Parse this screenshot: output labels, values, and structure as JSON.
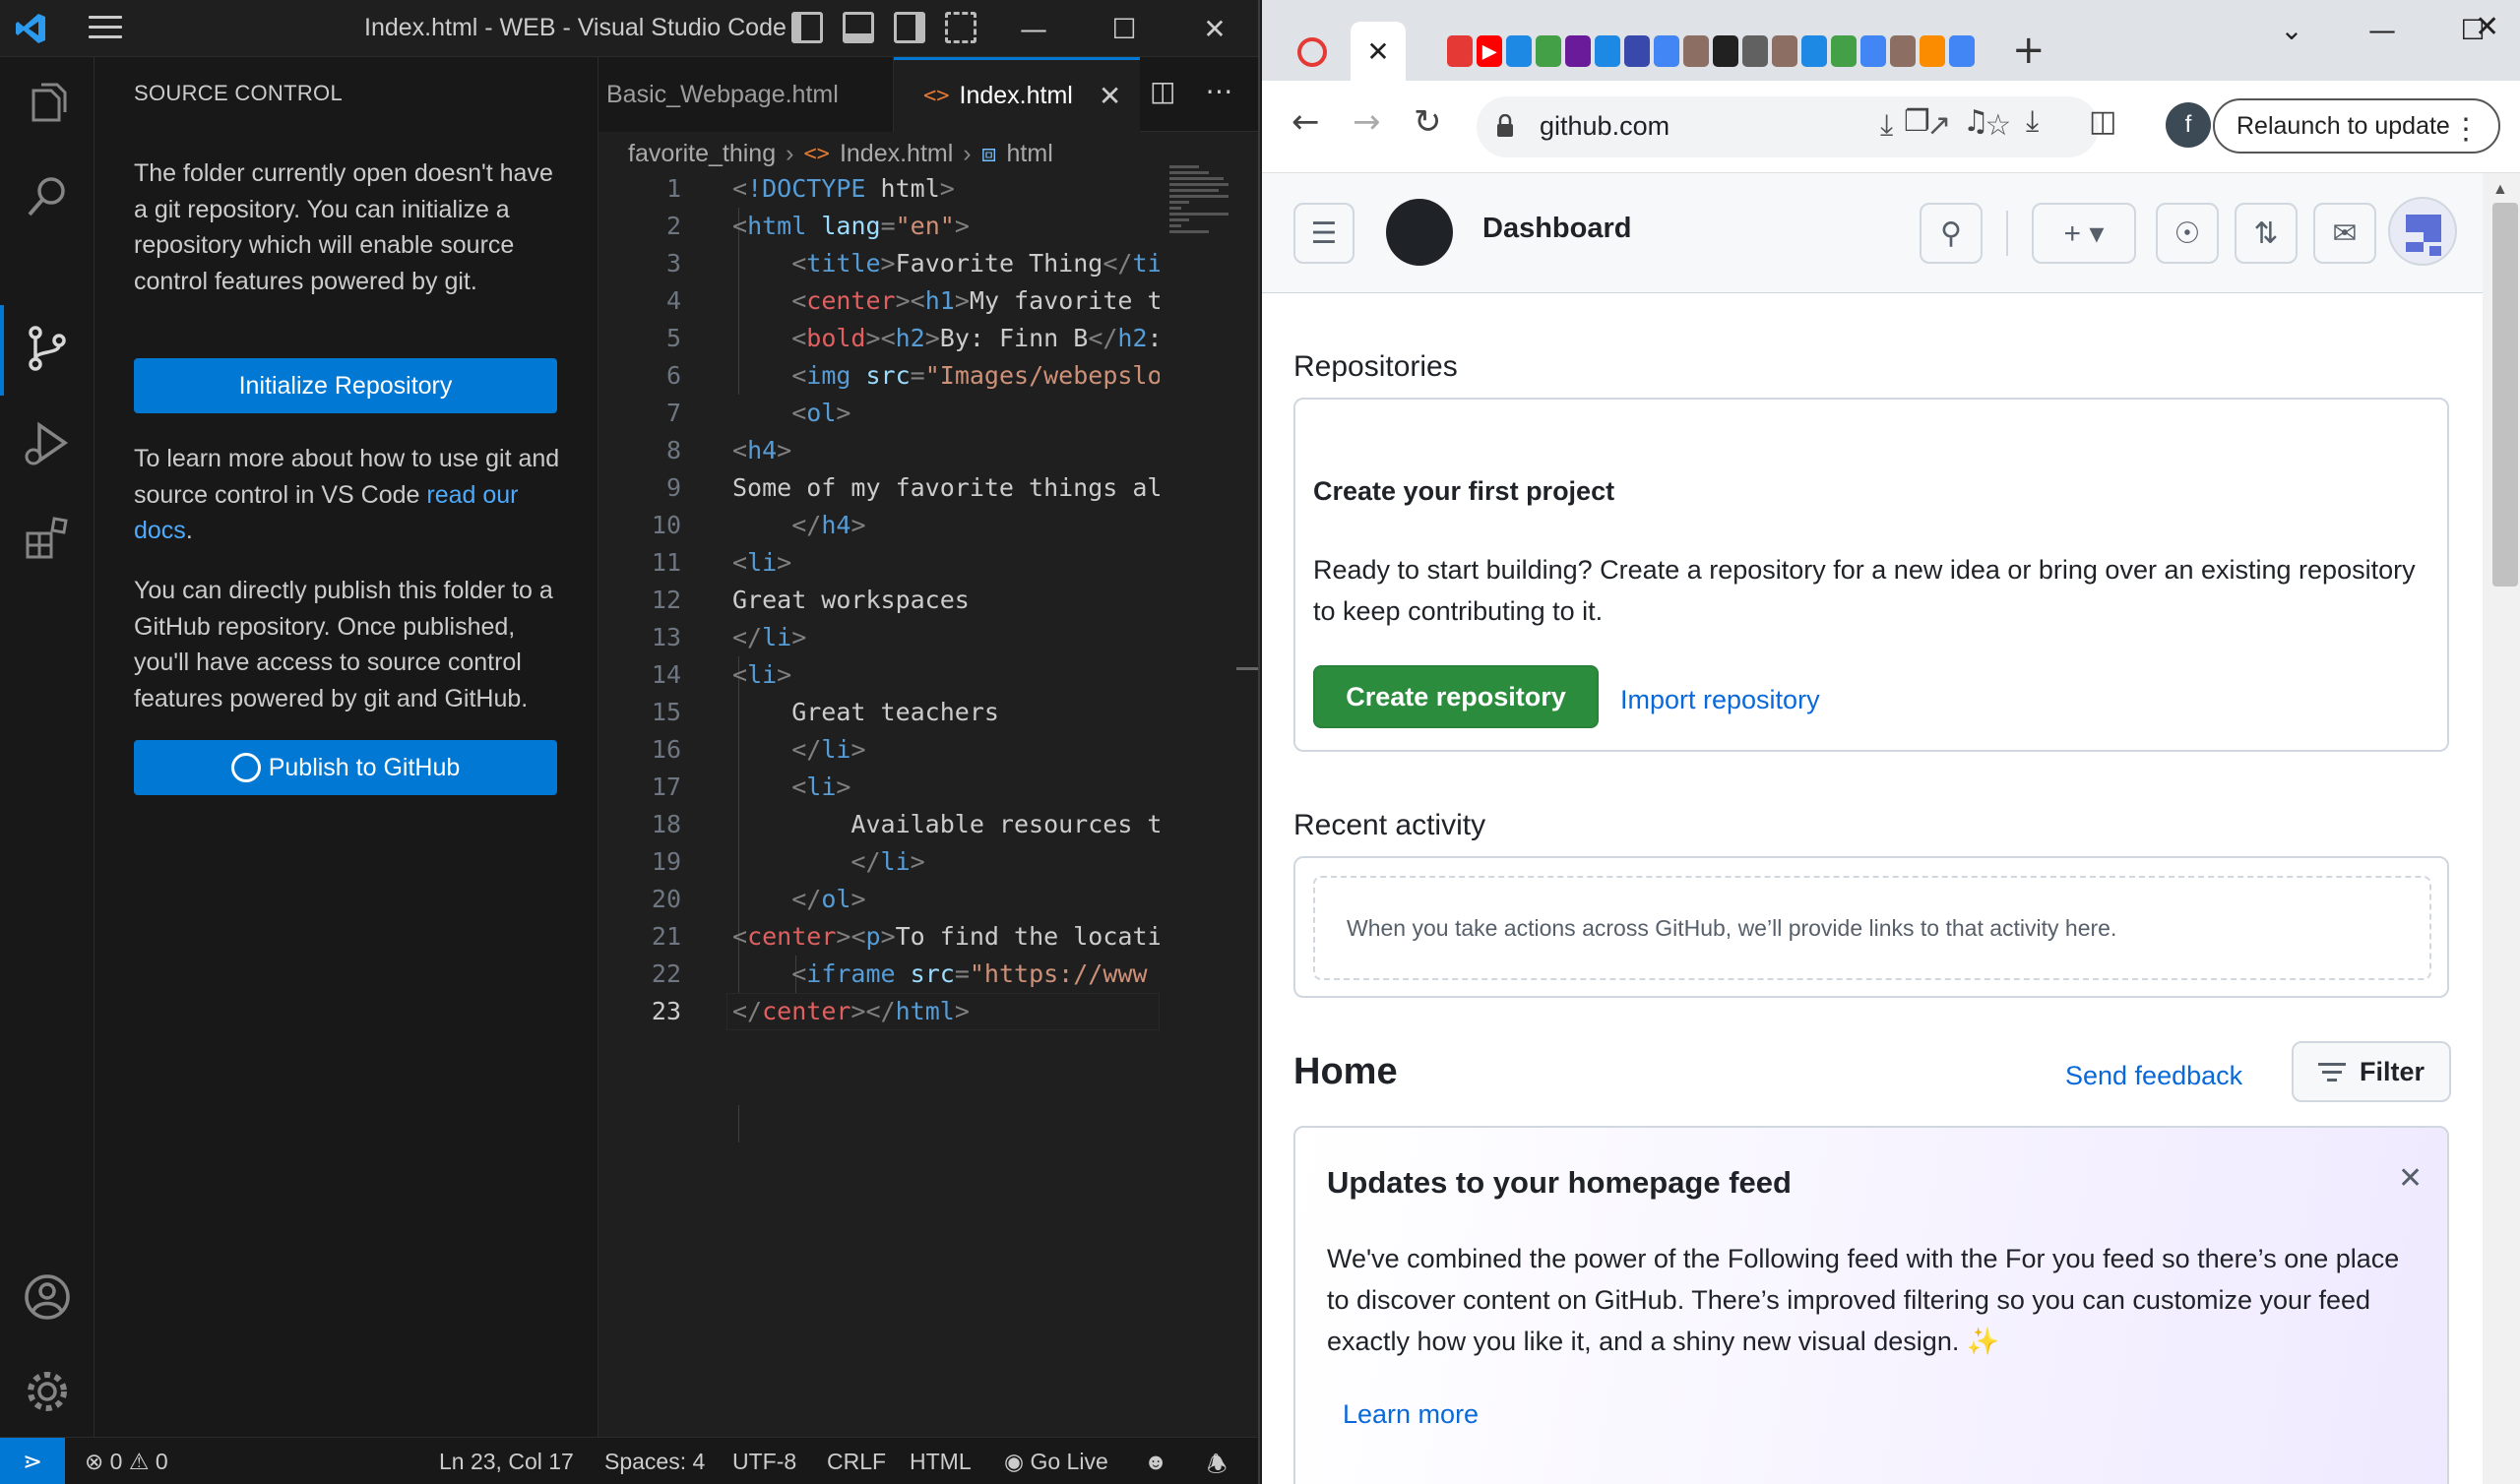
{
  "vscode": {
    "window_title": "Index.html - WEB - Visual Studio Code",
    "sidebar": {
      "header": "SOURCE CONTROL",
      "intro": "The folder currently open doesn't have a git repository. You can initialize a repository which will enable source control features powered by git.",
      "init_button": "Initialize Repository",
      "learn_prefix": "To learn more about how to use git and source control in VS Code ",
      "learn_link": "read our docs",
      "learn_suffix": ".",
      "publish_text": "You can directly publish this folder to a GitHub repository. Once published, you'll have access to source control features powered by git and GitHub.",
      "publish_button": "Publish to GitHub"
    },
    "tabs": [
      {
        "label": "Basic_Webpage.html",
        "active": false
      },
      {
        "label": "Index.html",
        "active": true
      }
    ],
    "breadcrumb": {
      "folder": "favorite_thing",
      "file": "Index.html",
      "symbol": "html"
    },
    "code_lines": [
      {
        "n": "1",
        "text": "<!DOCTYPE html>"
      },
      {
        "n": "2",
        "text": "<html lang=\"en\">"
      },
      {
        "n": "3",
        "text": "    <title>Favorite Thing</ti"
      },
      {
        "n": "4",
        "text": "    <center><h1>My favorite t"
      },
      {
        "n": "5",
        "text": "    <bold><h2>By: Finn B</h2:"
      },
      {
        "n": "6",
        "text": "    <img src=\"Images/webepslo"
      },
      {
        "n": "7",
        "text": "    <ol>"
      },
      {
        "n": "8",
        "text": "<h4>"
      },
      {
        "n": "9",
        "text": "Some of my favorite things al"
      },
      {
        "n": "10",
        "text": "    </h4>"
      },
      {
        "n": "11",
        "text": "<li>"
      },
      {
        "n": "12",
        "text": "Great workspaces"
      },
      {
        "n": "13",
        "text": "</li>"
      },
      {
        "n": "14",
        "text": "<li>"
      },
      {
        "n": "15",
        "text": "    Great teachers"
      },
      {
        "n": "16",
        "text": "    </li>"
      },
      {
        "n": "17",
        "text": "    <li>"
      },
      {
        "n": "18",
        "text": "        Available resources t"
      },
      {
        "n": "19",
        "text": "        </li>"
      },
      {
        "n": "20",
        "text": "    </ol>"
      },
      {
        "n": "21",
        "text": "<center><p>To find the locati"
      },
      {
        "n": "22",
        "text": "    <iframe src=\"https://www"
      },
      {
        "n": "23",
        "text": "</center></html>"
      }
    ],
    "status": {
      "errors": "0",
      "warnings": "0",
      "position": "Ln 23, Col 17",
      "spaces": "Spaces: 4",
      "encoding": "UTF-8",
      "eol": "CRLF",
      "language": "HTML",
      "go_live": "Go Live"
    }
  },
  "chrome": {
    "url": "github.com",
    "profile_initial": "f",
    "relaunch": "Relaunch to update"
  },
  "github": {
    "header_title": "Dashboard",
    "repositories_heading": "Repositories",
    "project_title": "Create your first project",
    "project_desc": "Ready to start building? Create a repository for a new idea or bring over an existing repository to keep contributing to it.",
    "create_button": "Create repository",
    "import_link": "Import repository",
    "recent_heading": "Recent activity",
    "recent_empty": "When you take actions across GitHub, we’ll provide links to that activity here.",
    "home_heading": "Home",
    "send_feedback": "Send feedback",
    "filter": "Filter",
    "updates_title": "Updates to your homepage feed",
    "updates_desc": "We've combined the power of the Following feed with the For you feed so there’s one place to discover content on GitHub. There’s improved filtering so you can customize your feed exactly how you like it, and a shiny new visual design. ✨",
    "learn_more": "Learn more"
  }
}
